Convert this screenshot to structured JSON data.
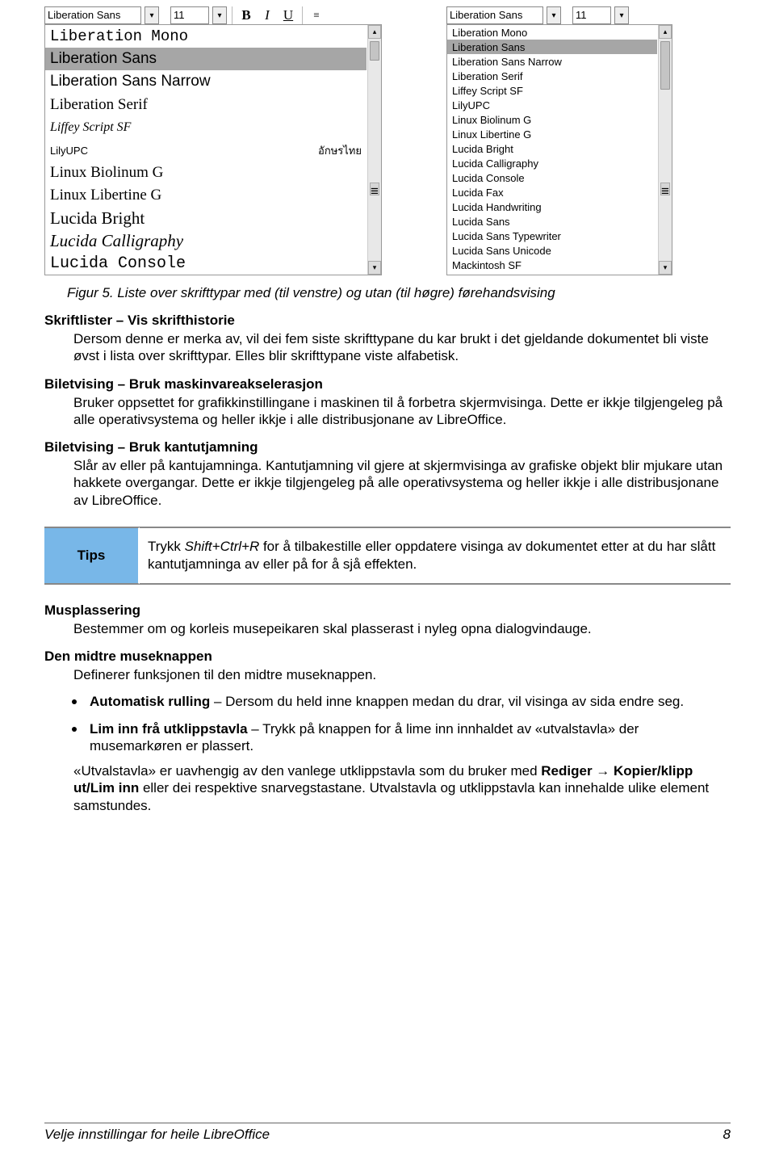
{
  "left_toolbar": {
    "font_name": "Liberation Sans",
    "size": "11",
    "bold": "B",
    "italic": "I",
    "under": "U",
    "align": "≡"
  },
  "right_toolbar": {
    "font_name": "Liberation Sans",
    "size": "11"
  },
  "left_fonts": [
    "Liberation Mono",
    "Liberation Sans",
    "Liberation Sans Narrow",
    "Liberation Serif",
    "Liffey Script SF",
    "LilyUPC",
    "Linux Biolinum G",
    "Linux Libertine G",
    "Lucida Bright",
    "Lucida Calligraphy",
    "Lucida Console"
  ],
  "left_lily_preview": "อักษรไทย",
  "right_fonts": [
    "Liberation Mono",
    "Liberation Sans",
    "Liberation Sans Narrow",
    "Liberation Serif",
    "Liffey Script SF",
    "LilyUPC",
    "Linux Biolinum G",
    "Linux Libertine G",
    "Lucida Bright",
    "Lucida Calligraphy",
    "Lucida Console",
    "Lucida Fax",
    "Lucida Handwriting",
    "Lucida Sans",
    "Lucida Sans Typewriter",
    "Lucida Sans Unicode",
    "Mackintosh SF"
  ],
  "caption": "Figur 5. Liste over skrifttypar med (til venstre) og utan (til høgre) førehandsvising",
  "s1": {
    "h": "Skriftlister – Vis skrifthistorie",
    "p": "Dersom denne er merka av, vil dei fem siste skrifttypane du kar brukt i det gjeldande dokumentet bli viste øvst i lista over skrifttypar. Elles blir skrifttypane viste alfabetisk."
  },
  "s2": {
    "h": "Biletvising – Bruk maskinvareakselerasjon",
    "p": "Bruker oppsettet for grafikkinstillingane i maskinen til å forbetra skjermvisinga. Dette er ikkje tilgjengeleg på alle operativsystema og heller ikkje i alle distribusjonane av LibreOffice."
  },
  "s3": {
    "h": "Biletvising – Bruk kantutjamning",
    "p": "Slår av eller på kantujamninga. Kantutjamning vil gjere at skjermvisinga av grafiske objekt blir mjukare utan hakkete overgangar. Dette er ikkje tilgjengeleg på alle operativsystema og heller ikkje i alle distribusjonane av LibreOffice."
  },
  "tips": {
    "label": "Tips",
    "text_a": "Trykk ",
    "kbd": "Shift+Ctrl+R",
    "text_b": " for å tilbakestille eller oppdatere visinga av dokumentet etter at du har slått kantutjamninga av eller på for å sjå effekten."
  },
  "s4": {
    "h": "Musplassering",
    "p": "Bestemmer om og korleis musepeikaren skal plasserast i nyleg opna dialogvindauge."
  },
  "s5": {
    "h": "Den midtre museknappen",
    "p": "Definerer funksjonen til den midtre museknappen.",
    "b1a": "Automatisk rulling",
    "b1b": " – Dersom du held inne knappen medan du drar, vil visinga av sida endre seg.",
    "b2a": "Lim inn frå utklippstavla",
    "b2b": " – Trykk på knappen for å lime inn innhaldet av «utvalstavla» der musemarkøren er plassert.",
    "f1": "«Utvalstavla» er uavhengig av den vanlege utklippstavla som du bruker med ",
    "f2": "Rediger → Kopier/klipp ut/Lim inn",
    "f3": " eller dei respektive snarvegstastane. Utvalstavla og utklippstavla kan innehalde ulike element samstundes."
  },
  "footer": {
    "left": "Velje  innstillingar for heile LibreOffice",
    "right": "8"
  }
}
